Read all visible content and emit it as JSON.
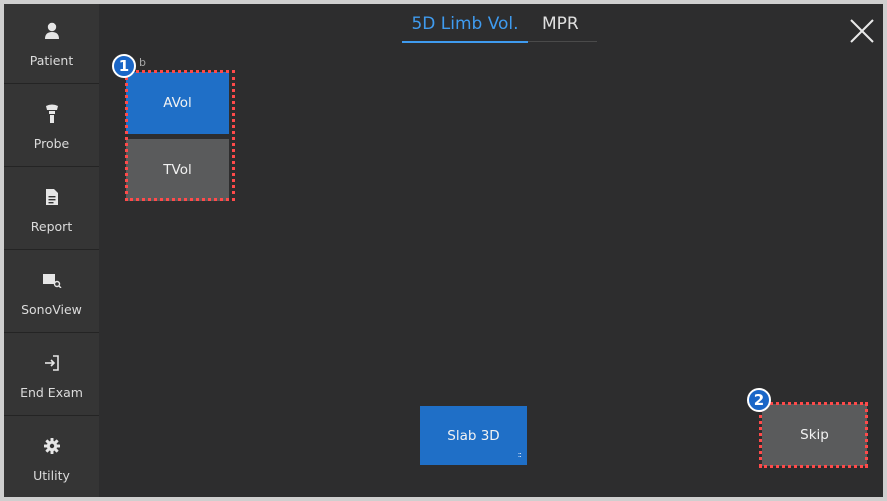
{
  "sidebar": {
    "items": [
      {
        "label": "Patient",
        "icon": "person-icon"
      },
      {
        "label": "Probe",
        "icon": "probe-icon"
      },
      {
        "label": "Report",
        "icon": "document-icon"
      },
      {
        "label": "SonoView",
        "icon": "image-search-icon"
      },
      {
        "label": "End Exam",
        "icon": "exit-icon"
      },
      {
        "label": "Utility",
        "icon": "gear-icon"
      }
    ]
  },
  "tabs": [
    {
      "label": "5D Limb Vol.",
      "active": true
    },
    {
      "label": "MPR",
      "active": false
    }
  ],
  "section": {
    "label": "b"
  },
  "buttons": {
    "avol": "AVol",
    "tvol": "TVol",
    "slab3d": "Slab 3D",
    "skip": "Skip"
  },
  "badges": {
    "one": "1",
    "two": "2"
  },
  "colors": {
    "accent": "#3f9bef",
    "button_blue": "#1f6fc7",
    "button_gray": "#5a5b5c",
    "highlight": "#ff4a4a"
  }
}
